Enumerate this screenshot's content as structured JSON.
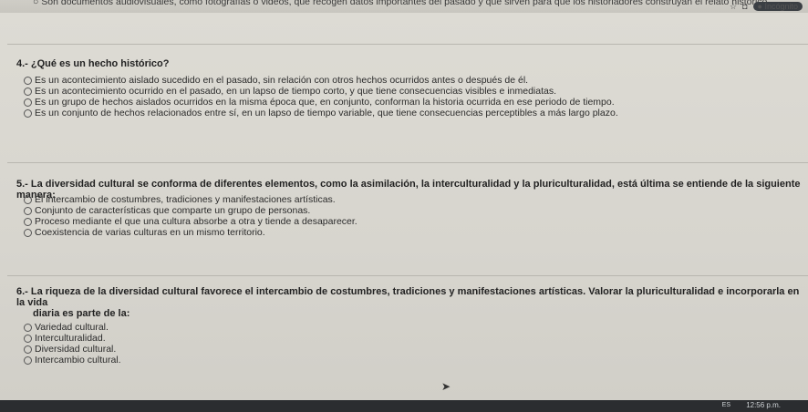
{
  "prev_text": "○ Son documentos audiovisuales, como fotografías o videos, que recogen datos importantes del pasado y que sirven para que los historiadores construyan el relato histórico",
  "browser": {
    "incognito_label": "Incógnito",
    "icons": [
      "star-icon",
      "tab-square-icon",
      "incognito-avatar-icon"
    ]
  },
  "questions": [
    {
      "number": "4.-",
      "text": "¿Qué es un hecho histórico?",
      "options": [
        "Es un acontecimiento aislado sucedido en el pasado, sin relación con otros hechos ocurridos antes o después de él.",
        "Es un acontecimiento ocurrido en el pasado, en un lapso de tiempo corto, y que tiene consecuencias visibles e inmediatas.",
        "Es un grupo de hechos aislados ocurridos en la misma época que, en conjunto, conforman la historia ocurrida en ese periodo de tiempo.",
        "Es un conjunto de hechos relacionados entre sí, en un lapso de tiempo variable, que tiene consecuencias perceptibles a más largo plazo."
      ]
    },
    {
      "number": "5.-",
      "text": "La diversidad cultural se conforma de diferentes elementos, como la asimilación, la interculturalidad y la pluriculturalidad, está última se entiende de la siguiente manera:",
      "options": [
        "El intercambio de costumbres, tradiciones y manifestaciones artísticas.",
        "Conjunto de características que comparte un grupo de personas.",
        "Proceso mediante el que una cultura absorbe a otra y tiende a desaparecer.",
        "Coexistencia de varias culturas en un mismo territorio."
      ]
    },
    {
      "number": "6.-",
      "text": "La riqueza de la diversidad cultural favorece el intercambio de costumbres, tradiciones y manifestaciones artísticas. Valorar la pluriculturalidad e incorporarla en la vida",
      "text2": "diaria es parte de la:",
      "options": [
        "Variedad cultural.",
        "Interculturalidad.",
        "Diversidad cultural.",
        "Intercambio cultural."
      ]
    }
  ],
  "taskbar": {
    "lang": "ES",
    "time": "12:56 p.m."
  }
}
